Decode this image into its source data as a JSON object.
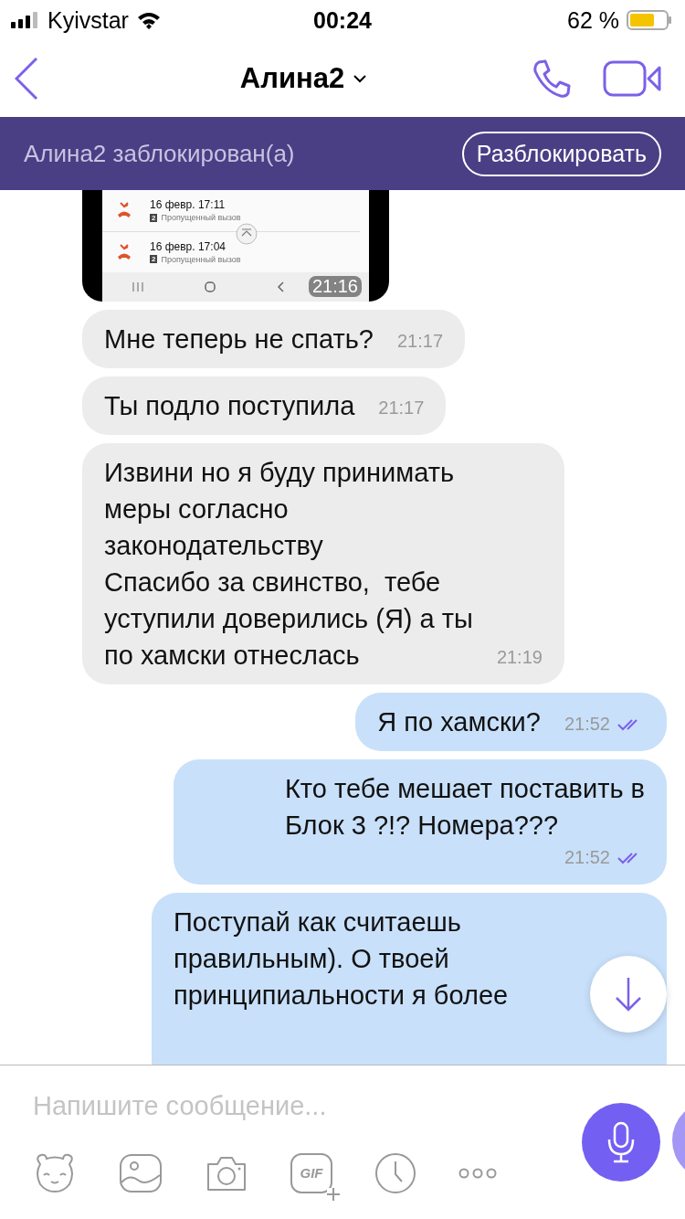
{
  "status_bar": {
    "carrier": "Kyivstar",
    "time": "00:24",
    "battery": "62 %"
  },
  "header": {
    "title": "Алина2"
  },
  "block_banner": {
    "text": "Алина2 заблокирован(а)",
    "button": "Разблокировать"
  },
  "messages": [
    {
      "kind": "image",
      "calls": [
        {
          "date": "16 февр. 17:11",
          "count": "2",
          "label": "Пропущенный вызов"
        },
        {
          "date": "16 февр. 17:04",
          "count": "2",
          "label": "Пропущенный вызов"
        }
      ],
      "time": "21:16"
    },
    {
      "kind": "incoming",
      "text": "Мне теперь не спать?",
      "time": "21:17"
    },
    {
      "kind": "incoming",
      "text": "Ты подло поступила",
      "time": "21:17"
    },
    {
      "kind": "incoming",
      "text": "Извини но я буду принимать\nмеры согласно\nзаконодательству\nСпасибо за свинство,  тебе\nуступили доверились (Я) а ты\nпо хамски отнеслась",
      "time": "21:19"
    },
    {
      "kind": "outgoing",
      "text": "Я по хамски?",
      "time": "21:52",
      "read": true
    },
    {
      "kind": "outgoing",
      "text": "Кто тебе мешает поставить в\nБлок 3 ?!? Номера???",
      "time": "21:52",
      "read": true
    },
    {
      "kind": "outgoing",
      "text": "Поступай как считаешь\nправильным). О твоей\nпринципиальности я более"
    }
  ],
  "composer": {
    "placeholder": "Напишите сообщение...",
    "gif_label": "GIF"
  }
}
